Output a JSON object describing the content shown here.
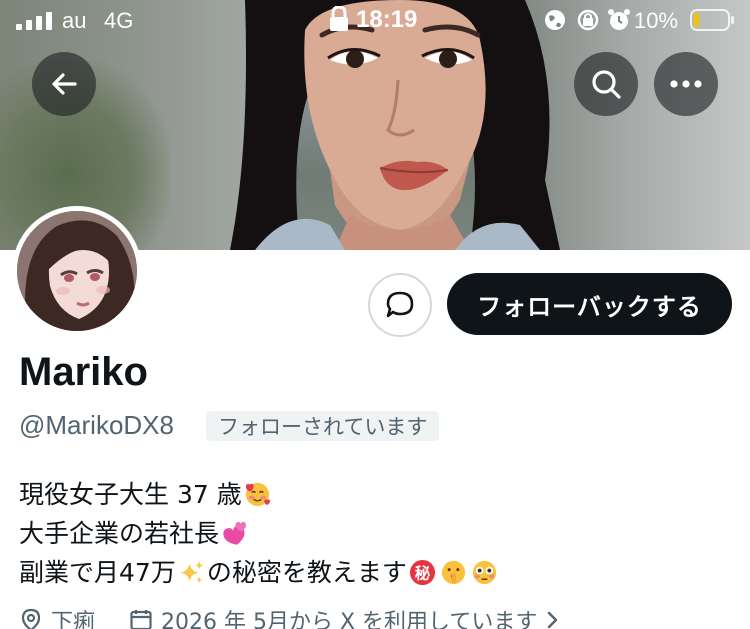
{
  "status_bar": {
    "carrier": "au",
    "network": "4G",
    "time": "18:19",
    "battery": "10%"
  },
  "profile": {
    "display_name": "Mariko",
    "handle": "@MarikoDX8",
    "follows_you": "フォローされています",
    "follow_back_button": "フォローバックする",
    "bio": [
      {
        "text": "現役女子大生 37 歳",
        "emoji": [
          "smiling-face-with-hearts"
        ]
      },
      {
        "text": "大手企業の若社長",
        "emoji": [
          "revolving-hearts"
        ]
      },
      {
        "text_before": "副業で月47万",
        "mid_emoji": "sparkles",
        "text_after": "の秘密を教えます",
        "emoji": [
          "secret-ideograph",
          "shushing-face",
          "flushed-face"
        ]
      }
    ],
    "location": "下痢",
    "joined": "2026 年 5月から X を利用しています"
  },
  "colors": {
    "text_primary": "#0f1419",
    "text_secondary": "#536471",
    "follow_button_bg": "#0f1419",
    "badge_bg": "#eff3f4"
  }
}
